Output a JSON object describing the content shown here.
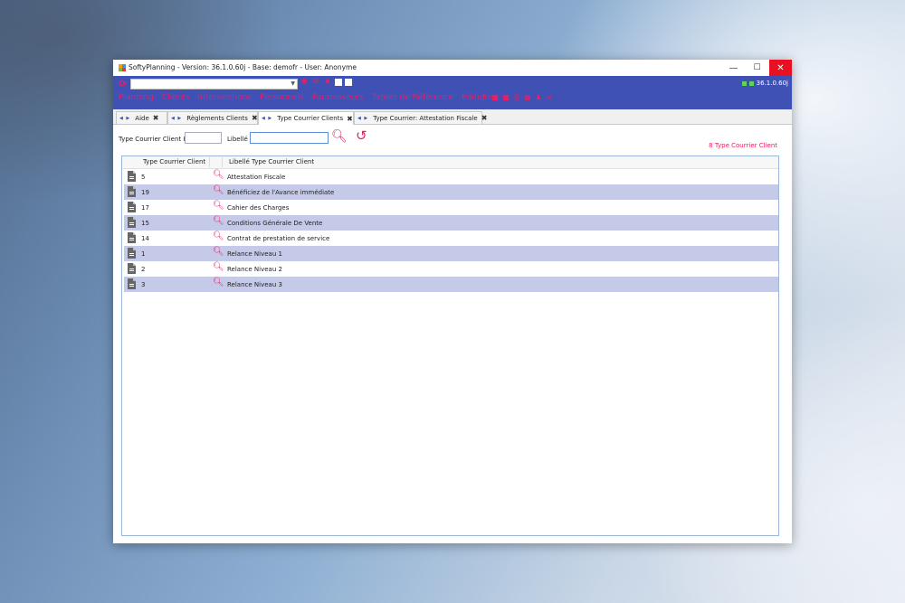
{
  "window": {
    "title": "SoftyPlanning - Version: 36.1.0.60j - Base: demofr - User: Anonyme",
    "controls": {
      "minimize": "—",
      "maximize": "☐",
      "close": "✕"
    }
  },
  "toolbar": {
    "status_version": "36.1.0.60j",
    "combo_value": "",
    "status_color": "#5ed35e"
  },
  "menu": {
    "items": [
      "Planning",
      "Clients",
      "Interventions",
      "Personnels",
      "Fournisseurs",
      "Tables de Référence",
      "Editions"
    ],
    "color": "#e91e63"
  },
  "tabs": [
    {
      "label": "Aide"
    },
    {
      "label": "Règlements Clients"
    },
    {
      "label": "Type Courrier Clients"
    },
    {
      "label": "Type Courrier: Attestation Fiscale"
    }
  ],
  "filters": {
    "id_label": "Type Courrier Client Id",
    "id_value": "",
    "libelle_label": "Libellé",
    "libelle_value": ""
  },
  "count_text": "8 Type Courrier Client",
  "grid": {
    "headers": [
      "Type Courrier Client",
      "Libellé Type Courrier Client"
    ],
    "rows": [
      {
        "id": "5",
        "libelle": "Attestation Fiscale"
      },
      {
        "id": "19",
        "libelle": "Bénéficiez de l'Avance immédiate"
      },
      {
        "id": "17",
        "libelle": "Cahier des Charges"
      },
      {
        "id": "15",
        "libelle": "Conditions Générale De Vente"
      },
      {
        "id": "14",
        "libelle": "Contrat de prestation de service"
      },
      {
        "id": "1",
        "libelle": "Relance Niveau 1"
      },
      {
        "id": "2",
        "libelle": "Relance Niveau 2"
      },
      {
        "id": "3",
        "libelle": "Relance Niveau 3"
      }
    ],
    "alt_row_color": "#c5cae9"
  },
  "colors": {
    "accent": "#e91e63",
    "toolbar": "#3f51b5"
  }
}
